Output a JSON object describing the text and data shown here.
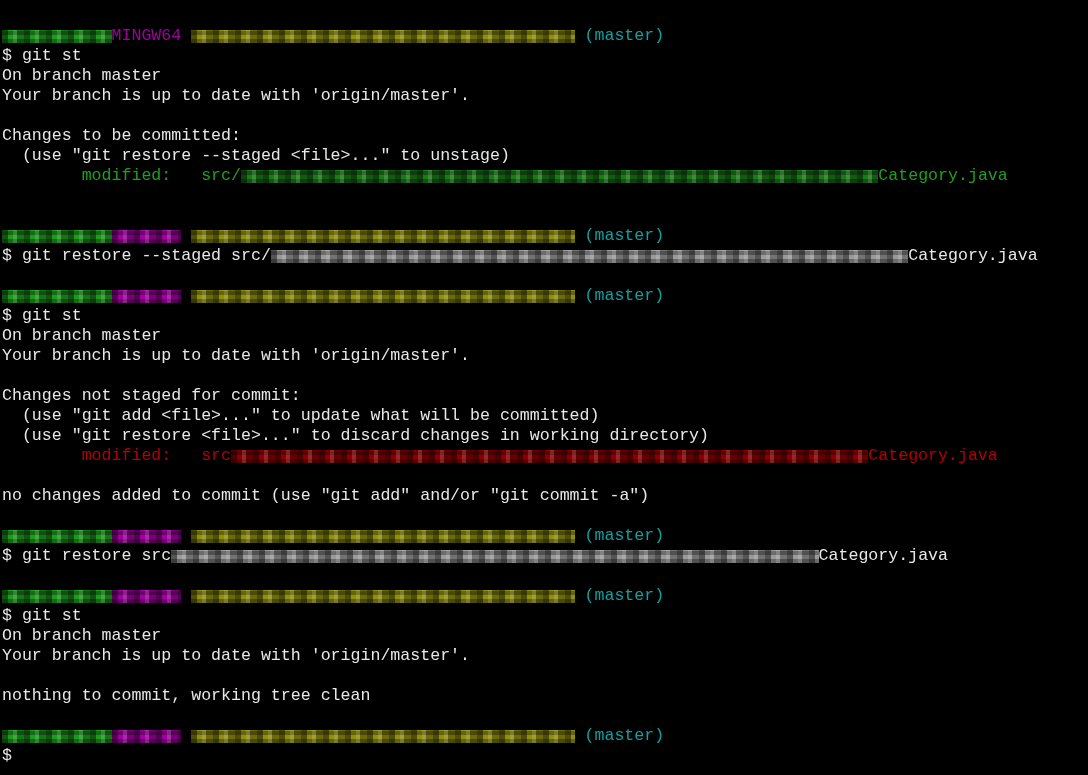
{
  "terminal": {
    "lines": [
      {
        "kind": "blank"
      },
      {
        "kind": "line",
        "segments": [
          {
            "kind": "namemask",
            "color": "#1e9a1e"
          },
          {
            "kind": "text",
            "text": "MINGW64",
            "color": "#a000a0"
          },
          {
            "kind": "dirmask",
            "color": "#8f8f10"
          },
          {
            "kind": "text",
            "text": " (master)",
            "color": "#10a0a0"
          }
        ]
      },
      {
        "kind": "line",
        "segments": [
          {
            "kind": "text",
            "text": "$ git st",
            "color": "#e8e8e8"
          }
        ]
      },
      {
        "kind": "line",
        "segments": [
          {
            "kind": "text",
            "text": "On branch master",
            "color": "#e8e8e8"
          }
        ]
      },
      {
        "kind": "line",
        "segments": [
          {
            "kind": "text",
            "text": "Your branch is up to date with 'origin/master'.",
            "color": "#e8e8e8"
          }
        ]
      },
      {
        "kind": "blank"
      },
      {
        "kind": "line",
        "segments": [
          {
            "kind": "text",
            "text": "Changes to be committed:",
            "color": "#e8e8e8"
          }
        ]
      },
      {
        "kind": "line",
        "segments": [
          {
            "kind": "text",
            "text": "  (use \"git restore --staged <file>...\" to unstage)",
            "color": "#e8e8e8"
          }
        ]
      },
      {
        "kind": "line",
        "segments": [
          {
            "kind": "text",
            "text": "        modified:   src/",
            "color": "#1ea01e"
          },
          {
            "kind": "pathmask",
            "color": "#1a7a1a"
          },
          {
            "kind": "text",
            "text": "Category.java",
            "color": "#1ea01e"
          }
        ]
      },
      {
        "kind": "blank"
      },
      {
        "kind": "blank"
      },
      {
        "kind": "line",
        "segments": [
          {
            "kind": "namemask",
            "color": "#1e9a1e"
          },
          {
            "kind": "hostmask",
            "color": "#a000a0"
          },
          {
            "kind": "dirmask",
            "color": "#8f8f10"
          },
          {
            "kind": "text",
            "text": " (master)",
            "color": "#10a0a0"
          }
        ]
      },
      {
        "kind": "line",
        "segments": [
          {
            "kind": "text",
            "text": "$ git restore --staged src/",
            "color": "#e8e8e8"
          },
          {
            "kind": "pathmask",
            "color": "#9a9a9a"
          },
          {
            "kind": "text",
            "text": "Category.java",
            "color": "#e8e8e8"
          }
        ]
      },
      {
        "kind": "blank"
      },
      {
        "kind": "line",
        "segments": [
          {
            "kind": "namemask",
            "color": "#1e9a1e"
          },
          {
            "kind": "hostmask",
            "color": "#a000a0"
          },
          {
            "kind": "dirmask",
            "color": "#8f8f10"
          },
          {
            "kind": "text",
            "text": " (master)",
            "color": "#10a0a0"
          }
        ]
      },
      {
        "kind": "line",
        "segments": [
          {
            "kind": "text",
            "text": "$ git st",
            "color": "#e8e8e8"
          }
        ]
      },
      {
        "kind": "line",
        "segments": [
          {
            "kind": "text",
            "text": "On branch master",
            "color": "#e8e8e8"
          }
        ]
      },
      {
        "kind": "line",
        "segments": [
          {
            "kind": "text",
            "text": "Your branch is up to date with 'origin/master'.",
            "color": "#e8e8e8"
          }
        ]
      },
      {
        "kind": "blank"
      },
      {
        "kind": "line",
        "segments": [
          {
            "kind": "text",
            "text": "Changes not staged for commit:",
            "color": "#e8e8e8"
          }
        ]
      },
      {
        "kind": "line",
        "segments": [
          {
            "kind": "text",
            "text": "  (use \"git add <file>...\" to update what will be committed)",
            "color": "#e8e8e8"
          }
        ]
      },
      {
        "kind": "line",
        "segments": [
          {
            "kind": "text",
            "text": "  (use \"git restore <file>...\" to discard changes in working directory)",
            "color": "#e8e8e8"
          }
        ]
      },
      {
        "kind": "line",
        "segments": [
          {
            "kind": "text",
            "text": "        modified:   src",
            "color": "#b40000"
          },
          {
            "kind": "pathmask",
            "color": "#8a0000"
          },
          {
            "kind": "text",
            "text": "Category.java",
            "color": "#b40000"
          }
        ]
      },
      {
        "kind": "blank"
      },
      {
        "kind": "line",
        "segments": [
          {
            "kind": "text",
            "text": "no changes added to commit (use \"git add\" and/or \"git commit -a\")",
            "color": "#e8e8e8"
          }
        ]
      },
      {
        "kind": "blank"
      },
      {
        "kind": "line",
        "segments": [
          {
            "kind": "namemask",
            "color": "#1e9a1e"
          },
          {
            "kind": "hostmask",
            "color": "#a000a0"
          },
          {
            "kind": "dirmask",
            "color": "#8f8f10"
          },
          {
            "kind": "text",
            "text": " (master)",
            "color": "#10a0a0"
          }
        ]
      },
      {
        "kind": "line",
        "segments": [
          {
            "kind": "text",
            "text": "$ git restore src",
            "color": "#e8e8e8"
          },
          {
            "kind": "longmask",
            "color": "#9a9a9a"
          },
          {
            "kind": "text",
            "text": "Category.java",
            "color": "#e8e8e8"
          }
        ]
      },
      {
        "kind": "blank"
      },
      {
        "kind": "line",
        "segments": [
          {
            "kind": "namemask",
            "color": "#1e9a1e"
          },
          {
            "kind": "hostmask",
            "color": "#a000a0"
          },
          {
            "kind": "dirmask",
            "color": "#8f8f10"
          },
          {
            "kind": "text",
            "text": " (master)",
            "color": "#10a0a0"
          }
        ]
      },
      {
        "kind": "line",
        "segments": [
          {
            "kind": "text",
            "text": "$ git st",
            "color": "#e8e8e8"
          }
        ]
      },
      {
        "kind": "line",
        "segments": [
          {
            "kind": "text",
            "text": "On branch master",
            "color": "#e8e8e8"
          }
        ]
      },
      {
        "kind": "line",
        "segments": [
          {
            "kind": "text",
            "text": "Your branch is up to date with 'origin/master'.",
            "color": "#e8e8e8"
          }
        ]
      },
      {
        "kind": "blank"
      },
      {
        "kind": "line",
        "segments": [
          {
            "kind": "text",
            "text": "nothing to commit, working tree clean",
            "color": "#e8e8e8"
          }
        ]
      },
      {
        "kind": "blank"
      },
      {
        "kind": "line",
        "segments": [
          {
            "kind": "namemask",
            "color": "#1e9a1e"
          },
          {
            "kind": "hostmask",
            "color": "#a000a0"
          },
          {
            "kind": "dirmask",
            "color": "#8f8f10"
          },
          {
            "kind": "text",
            "text": " (master)",
            "color": "#10a0a0"
          }
        ]
      },
      {
        "kind": "line",
        "segments": [
          {
            "kind": "text",
            "text": "$",
            "color": "#e8e8e8"
          }
        ]
      }
    ]
  }
}
